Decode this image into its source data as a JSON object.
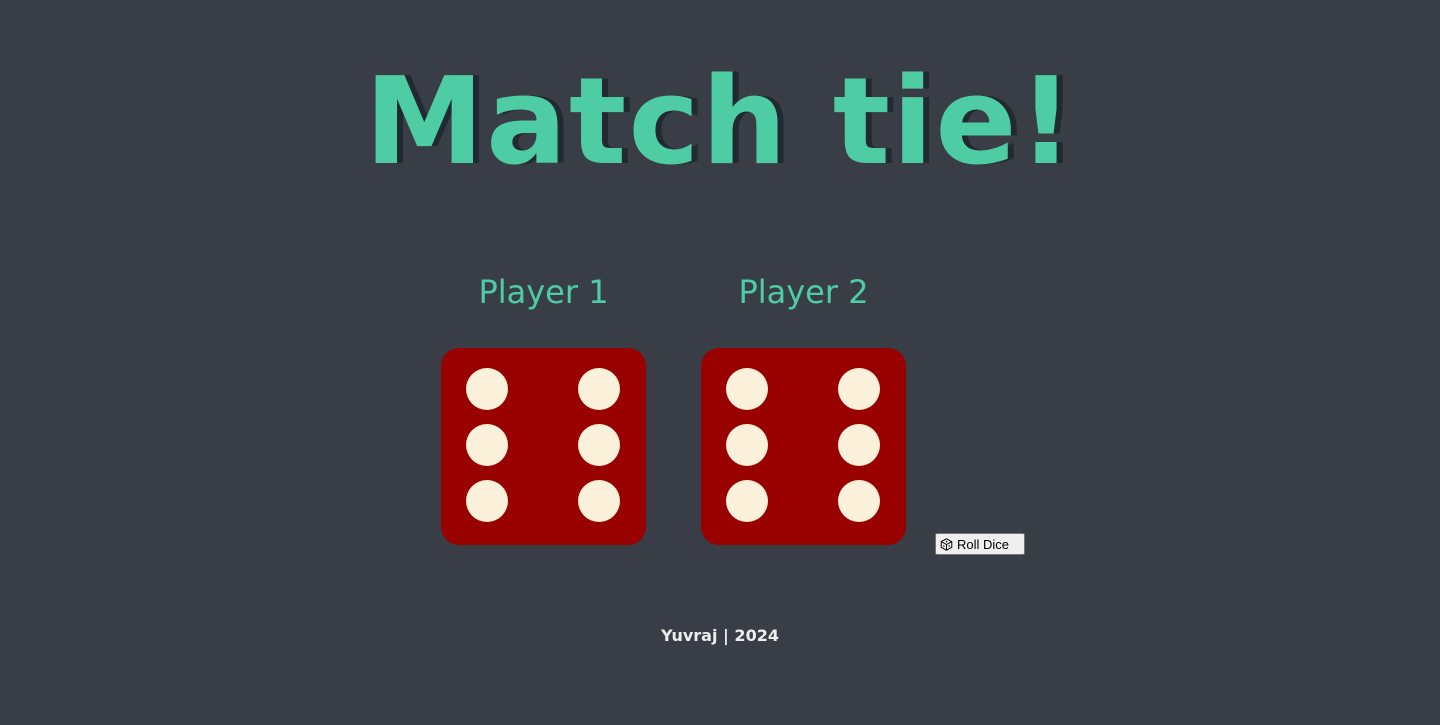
{
  "title": "Match tie!",
  "players": [
    {
      "name": "Player 1",
      "die_value": 6
    },
    {
      "name": "Player 2",
      "die_value": 6
    }
  ],
  "roll_button": {
    "label": "Roll Dice",
    "icon": "dice-icon"
  },
  "footer": "Yuvraj | 2024",
  "colors": {
    "background": "#393e46",
    "accent": "#4ecca3",
    "die": "#990000",
    "pip": "#fbf0d9"
  }
}
